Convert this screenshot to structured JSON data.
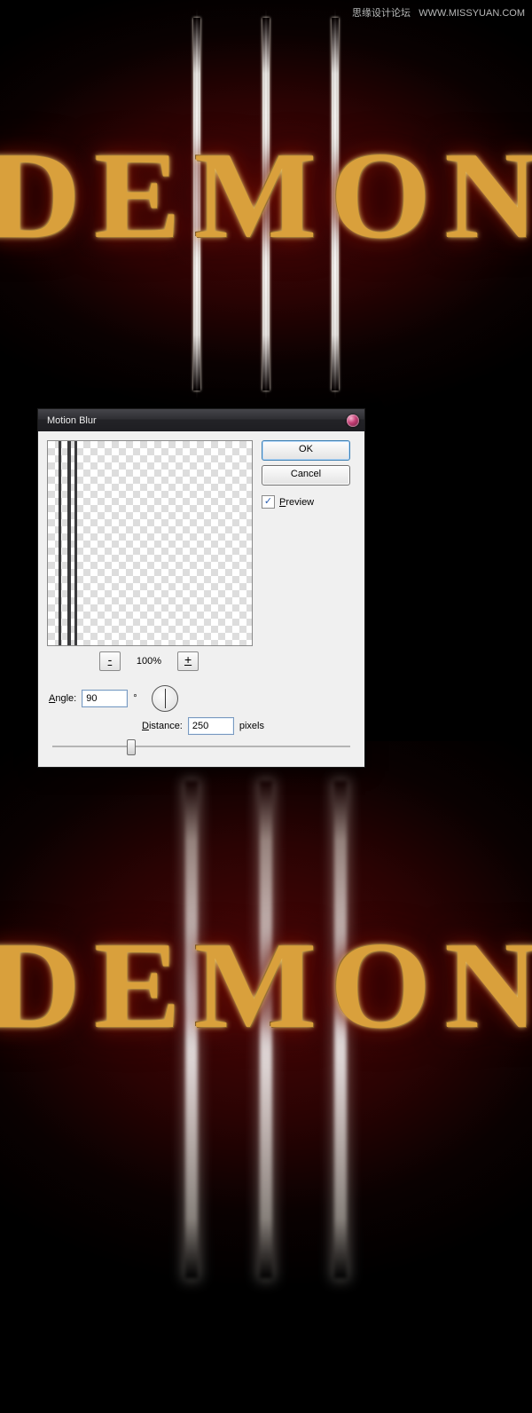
{
  "watermark": {
    "left": "思缘设计论坛",
    "right": "WWW.MISSYUAN.COM"
  },
  "artwork": {
    "title_text": "DEMON"
  },
  "dialog": {
    "title": "Motion Blur",
    "buttons": {
      "ok": "OK",
      "cancel": "Cancel"
    },
    "preview_label": "Preview",
    "preview_checked": true,
    "zoom": {
      "minus": "-",
      "plus": "+",
      "percent": "100%"
    },
    "angle": {
      "label_pre": "",
      "label_u": "A",
      "label_post": "ngle:",
      "value": "90",
      "degree": "°"
    },
    "distance": {
      "label_pre": "",
      "label_u": "D",
      "label_post": "istance:",
      "value": "250",
      "unit": "pixels"
    }
  }
}
